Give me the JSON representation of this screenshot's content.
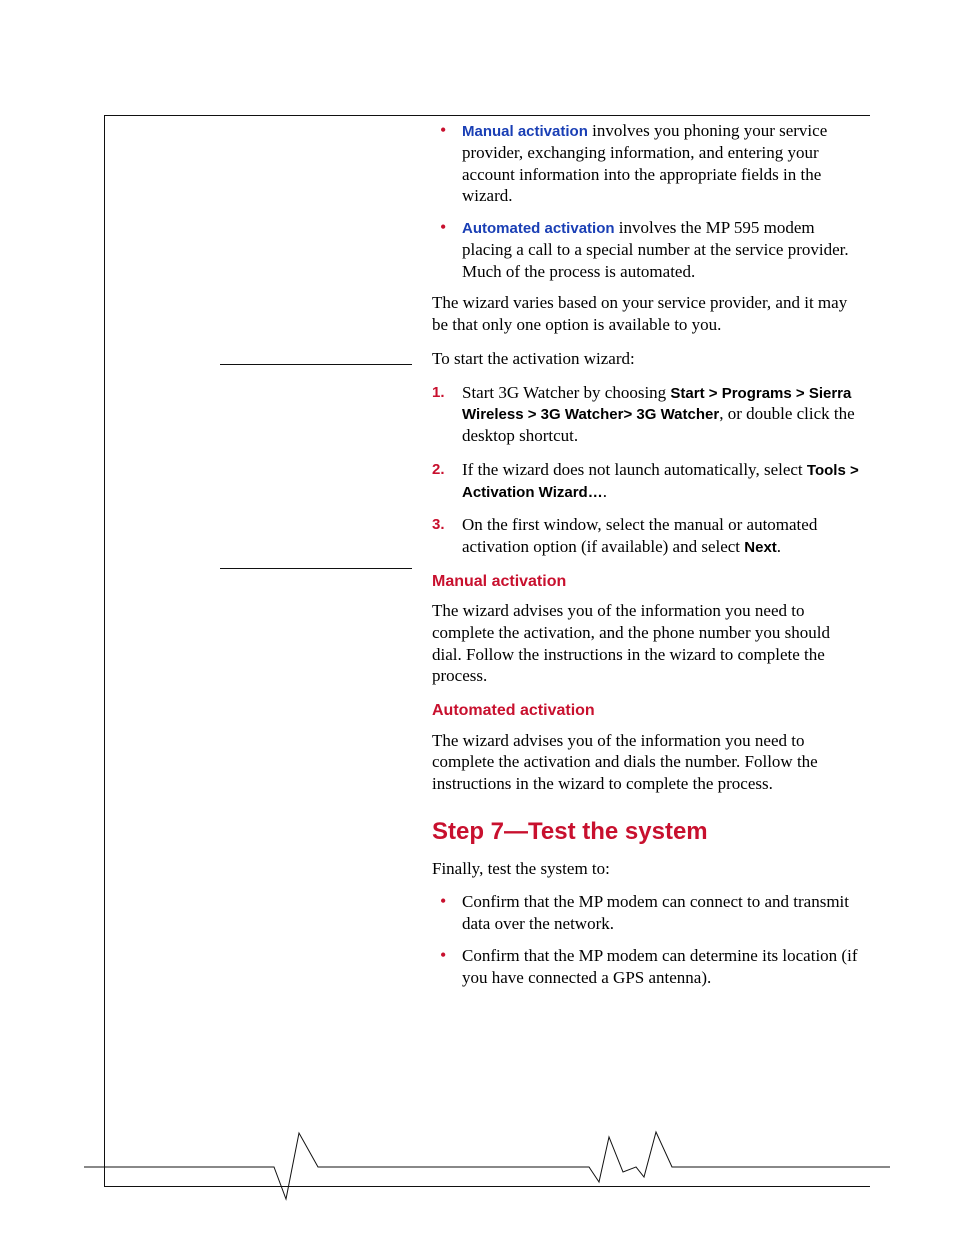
{
  "bullets_intro": [
    {
      "link": "Manual activation",
      "text": " involves you phoning your service provider, exchanging information, and entering your account information into the appropriate fields in the wizard."
    },
    {
      "link": "Automated activation",
      "text": " involves the MP 595 modem placing a call to a special number at the service provider. Much of the process is automated."
    }
  ],
  "wizard_note": "The wizard varies based on your service provider, and it may be that only one option is available to you.",
  "start_wizard": "To start the activation wizard:",
  "steps": [
    {
      "pre": "Start 3G Watcher by choosing ",
      "ui": "Start > Programs > Sierra Wireless > 3G Watcher> 3G Watcher",
      "post": ", or double click the desktop shortcut."
    },
    {
      "pre": "If the wizard does not launch automatically, select ",
      "ui": "Tools > Activation Wizard…",
      "post": "."
    },
    {
      "pre": "On the first window, select the manual or automated activation option (if available) and select ",
      "ui": "Next",
      "post": "."
    }
  ],
  "manual": {
    "heading": "Manual activation",
    "body": "The wizard advises you of the information you need to complete the activation, and the phone number you should dial. Follow the instructions in the wizard to complete the process."
  },
  "automated": {
    "heading": "Automated activation",
    "body": "The wizard advises you of the information you need to complete the activation and dials the number. Follow the instructions in the wizard to complete the process."
  },
  "step7": {
    "heading": "Step 7—Test the system",
    "intro": "Finally, test the system to:",
    "bullets": [
      "Confirm that the MP modem can connect to and transmit data over the network.",
      "Confirm that the MP modem can determine its location (if you have connected a GPS antenna)."
    ]
  }
}
